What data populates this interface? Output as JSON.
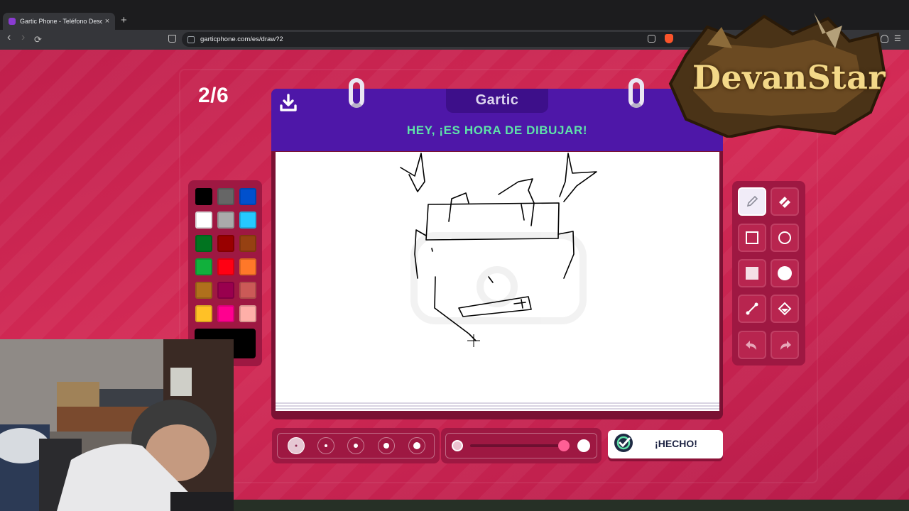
{
  "browser": {
    "tab_title": "Gartic Phone - Teléfono Descom",
    "tab_close": "×",
    "new_tab": "+",
    "back": "‹",
    "forward": "›",
    "reload": "⟳",
    "url": "garticphone.com/es/draw?2"
  },
  "game": {
    "round": "2/6",
    "logo": "Gartic",
    "prompt_banner": "HEY, ¡ES HORA DE DIBUJAR!",
    "done_label": "¡HECHO!",
    "palette": [
      "#000000",
      "#666666",
      "#0050cd",
      "#ffffff",
      "#aaaaaa",
      "#26c9ff",
      "#017420",
      "#990000",
      "#964112",
      "#11b03c",
      "#ff0013",
      "#ff7829",
      "#b0701c",
      "#99004e",
      "#cb5a57",
      "#ffc126",
      "#ff008f",
      "#feafa8"
    ],
    "current_color": "#000000",
    "tools": [
      "pencil",
      "eraser",
      "rectangle",
      "ellipse",
      "filled-rectangle",
      "filled-ellipse",
      "line",
      "fill-bucket",
      "undo",
      "redo"
    ],
    "active_tool": "pencil",
    "brush_sizes": [
      1,
      2,
      3,
      4,
      5
    ],
    "selected_brush_size": 1,
    "opacity_percent": 100
  },
  "overlay": {
    "streamer_logo": "DevanStar"
  }
}
